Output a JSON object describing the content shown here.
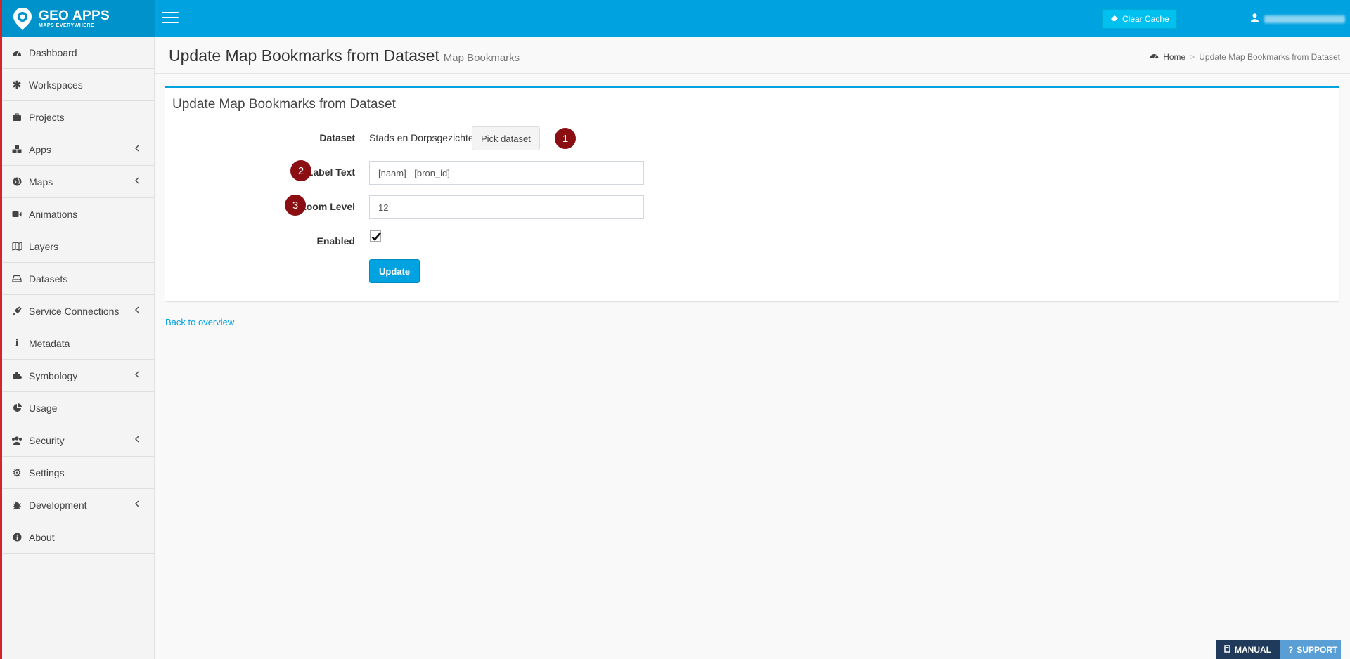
{
  "brand": {
    "title": "GEO APPS",
    "subtitle": "MAPS EVERYWHERE"
  },
  "header": {
    "clear_cache_label": "Clear Cache"
  },
  "sidebar": {
    "items": [
      {
        "label": "Dashboard",
        "icon": "dashboard-icon",
        "has_submenu": false
      },
      {
        "label": "Workspaces",
        "icon": "asterisk-icon",
        "has_submenu": false
      },
      {
        "label": "Projects",
        "icon": "briefcase-icon",
        "has_submenu": false
      },
      {
        "label": "Apps",
        "icon": "cubes-icon",
        "has_submenu": true
      },
      {
        "label": "Maps",
        "icon": "globe-icon",
        "has_submenu": true
      },
      {
        "label": "Animations",
        "icon": "video-camera-icon",
        "has_submenu": false
      },
      {
        "label": "Layers",
        "icon": "map-icon",
        "has_submenu": false
      },
      {
        "label": "Datasets",
        "icon": "hdd-icon",
        "has_submenu": false
      },
      {
        "label": "Service Connections",
        "icon": "plug-icon",
        "has_submenu": true
      },
      {
        "label": "Metadata",
        "icon": "info-icon",
        "has_submenu": false
      },
      {
        "label": "Symbology",
        "icon": "puzzle-icon",
        "has_submenu": true
      },
      {
        "label": "Usage",
        "icon": "pie-chart-icon",
        "has_submenu": false
      },
      {
        "label": "Security",
        "icon": "users-icon",
        "has_submenu": true
      },
      {
        "label": "Settings",
        "icon": "gear-icon",
        "has_submenu": false
      },
      {
        "label": "Development",
        "icon": "bug-icon",
        "has_submenu": true
      },
      {
        "label": "About",
        "icon": "info-circle-icon",
        "has_submenu": false
      }
    ]
  },
  "page": {
    "title": "Update Map Bookmarks from Dataset",
    "subtitle": "Map Bookmarks"
  },
  "breadcrumb": {
    "home": "Home",
    "current": "Update Map Bookmarks from Dataset"
  },
  "form": {
    "box_title": "Update Map Bookmarks from Dataset",
    "dataset_label": "Dataset",
    "dataset_value": "Stads en Dorpsgezichten",
    "pick_dataset_label": "Pick dataset",
    "label_text_label": "Label Text",
    "label_text_value": "[naam] - [bron_id]",
    "zoom_level_label": "Zoom Level",
    "zoom_level_value": "12",
    "enabled_label": "Enabled",
    "enabled": true,
    "update_label": "Update"
  },
  "markers": [
    "1",
    "2",
    "3"
  ],
  "back_link": "Back to overview",
  "floating": {
    "manual_label": "MANUAL",
    "support_label": "SUPPORT"
  },
  "colors": {
    "primary": "#00a2e0",
    "logo_bg": "#0092ca",
    "marker": "#8b0f12",
    "manual": "#1f3a5a",
    "support": "#5a9ed6"
  }
}
